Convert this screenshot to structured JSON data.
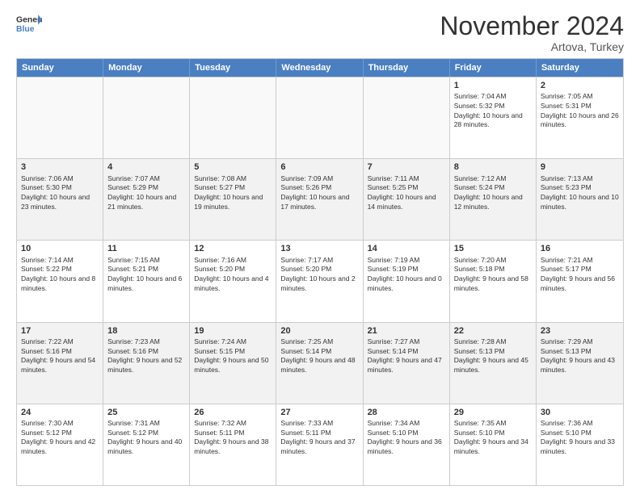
{
  "logo": {
    "line1": "General",
    "line2": "Blue"
  },
  "title": "November 2024",
  "location": "Artova, Turkey",
  "header": {
    "days": [
      "Sunday",
      "Monday",
      "Tuesday",
      "Wednesday",
      "Thursday",
      "Friday",
      "Saturday"
    ]
  },
  "rows": [
    [
      {
        "day": "",
        "text": ""
      },
      {
        "day": "",
        "text": ""
      },
      {
        "day": "",
        "text": ""
      },
      {
        "day": "",
        "text": ""
      },
      {
        "day": "",
        "text": ""
      },
      {
        "day": "1",
        "text": "Sunrise: 7:04 AM\nSunset: 5:32 PM\nDaylight: 10 hours and 28 minutes."
      },
      {
        "day": "2",
        "text": "Sunrise: 7:05 AM\nSunset: 5:31 PM\nDaylight: 10 hours and 26 minutes."
      }
    ],
    [
      {
        "day": "3",
        "text": "Sunrise: 7:06 AM\nSunset: 5:30 PM\nDaylight: 10 hours and 23 minutes."
      },
      {
        "day": "4",
        "text": "Sunrise: 7:07 AM\nSunset: 5:29 PM\nDaylight: 10 hours and 21 minutes."
      },
      {
        "day": "5",
        "text": "Sunrise: 7:08 AM\nSunset: 5:27 PM\nDaylight: 10 hours and 19 minutes."
      },
      {
        "day": "6",
        "text": "Sunrise: 7:09 AM\nSunset: 5:26 PM\nDaylight: 10 hours and 17 minutes."
      },
      {
        "day": "7",
        "text": "Sunrise: 7:11 AM\nSunset: 5:25 PM\nDaylight: 10 hours and 14 minutes."
      },
      {
        "day": "8",
        "text": "Sunrise: 7:12 AM\nSunset: 5:24 PM\nDaylight: 10 hours and 12 minutes."
      },
      {
        "day": "9",
        "text": "Sunrise: 7:13 AM\nSunset: 5:23 PM\nDaylight: 10 hours and 10 minutes."
      }
    ],
    [
      {
        "day": "10",
        "text": "Sunrise: 7:14 AM\nSunset: 5:22 PM\nDaylight: 10 hours and 8 minutes."
      },
      {
        "day": "11",
        "text": "Sunrise: 7:15 AM\nSunset: 5:21 PM\nDaylight: 10 hours and 6 minutes."
      },
      {
        "day": "12",
        "text": "Sunrise: 7:16 AM\nSunset: 5:20 PM\nDaylight: 10 hours and 4 minutes."
      },
      {
        "day": "13",
        "text": "Sunrise: 7:17 AM\nSunset: 5:20 PM\nDaylight: 10 hours and 2 minutes."
      },
      {
        "day": "14",
        "text": "Sunrise: 7:19 AM\nSunset: 5:19 PM\nDaylight: 10 hours and 0 minutes."
      },
      {
        "day": "15",
        "text": "Sunrise: 7:20 AM\nSunset: 5:18 PM\nDaylight: 9 hours and 58 minutes."
      },
      {
        "day": "16",
        "text": "Sunrise: 7:21 AM\nSunset: 5:17 PM\nDaylight: 9 hours and 56 minutes."
      }
    ],
    [
      {
        "day": "17",
        "text": "Sunrise: 7:22 AM\nSunset: 5:16 PM\nDaylight: 9 hours and 54 minutes."
      },
      {
        "day": "18",
        "text": "Sunrise: 7:23 AM\nSunset: 5:16 PM\nDaylight: 9 hours and 52 minutes."
      },
      {
        "day": "19",
        "text": "Sunrise: 7:24 AM\nSunset: 5:15 PM\nDaylight: 9 hours and 50 minutes."
      },
      {
        "day": "20",
        "text": "Sunrise: 7:25 AM\nSunset: 5:14 PM\nDaylight: 9 hours and 48 minutes."
      },
      {
        "day": "21",
        "text": "Sunrise: 7:27 AM\nSunset: 5:14 PM\nDaylight: 9 hours and 47 minutes."
      },
      {
        "day": "22",
        "text": "Sunrise: 7:28 AM\nSunset: 5:13 PM\nDaylight: 9 hours and 45 minutes."
      },
      {
        "day": "23",
        "text": "Sunrise: 7:29 AM\nSunset: 5:13 PM\nDaylight: 9 hours and 43 minutes."
      }
    ],
    [
      {
        "day": "24",
        "text": "Sunrise: 7:30 AM\nSunset: 5:12 PM\nDaylight: 9 hours and 42 minutes."
      },
      {
        "day": "25",
        "text": "Sunrise: 7:31 AM\nSunset: 5:12 PM\nDaylight: 9 hours and 40 minutes."
      },
      {
        "day": "26",
        "text": "Sunrise: 7:32 AM\nSunset: 5:11 PM\nDaylight: 9 hours and 38 minutes."
      },
      {
        "day": "27",
        "text": "Sunrise: 7:33 AM\nSunset: 5:11 PM\nDaylight: 9 hours and 37 minutes."
      },
      {
        "day": "28",
        "text": "Sunrise: 7:34 AM\nSunset: 5:10 PM\nDaylight: 9 hours and 36 minutes."
      },
      {
        "day": "29",
        "text": "Sunrise: 7:35 AM\nSunset: 5:10 PM\nDaylight: 9 hours and 34 minutes."
      },
      {
        "day": "30",
        "text": "Sunrise: 7:36 AM\nSunset: 5:10 PM\nDaylight: 9 hours and 33 minutes."
      }
    ]
  ]
}
